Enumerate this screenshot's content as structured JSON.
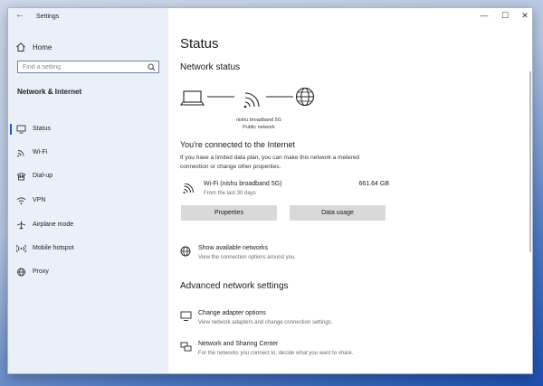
{
  "window": {
    "app_title": "Settings",
    "back_glyph": "←",
    "minimize_glyph": "—",
    "maximize_glyph": "☐",
    "close_glyph": "✕"
  },
  "sidebar": {
    "home_label": "Home",
    "search_placeholder": "Find a setting",
    "category": "Network & Internet",
    "items": [
      {
        "label": "Status",
        "icon": "status-icon",
        "selected": true
      },
      {
        "label": "Wi-Fi",
        "icon": "wifi-icon"
      },
      {
        "label": "Dial-up",
        "icon": "dialup-icon"
      },
      {
        "label": "VPN",
        "icon": "vpn-icon"
      },
      {
        "label": "Airplane mode",
        "icon": "airplane-icon"
      },
      {
        "label": "Mobile hotspot",
        "icon": "hotspot-icon"
      },
      {
        "label": "Proxy",
        "icon": "globe-icon"
      }
    ]
  },
  "main": {
    "title": "Status",
    "network_status_heading": "Network status",
    "network_name": "nishu broadband 5G",
    "network_type": "Public network",
    "connected_heading": "You're connected to the Internet",
    "connected_desc": "If you have a limited data plan, you can make this network a metered connection or change other properties.",
    "wifi": {
      "name": "Wi-Fi (nishu broadband 5G)",
      "sub": "From the last 30 days",
      "usage": "661.64 GB"
    },
    "buttons": {
      "properties": "Properties",
      "data_usage": "Data usage"
    },
    "show_networks": {
      "title": "Show available networks",
      "sub": "View the connection options around you."
    },
    "advanced_heading": "Advanced network settings",
    "change_adapter": {
      "title": "Change adapter options",
      "sub": "View network adapters and change connection settings."
    },
    "sharing_center": {
      "title": "Network and Sharing Center",
      "sub": "For the networks you connect to, decide what you want to share."
    }
  },
  "colors": {
    "accent": "#1f5bd0",
    "sidebar_bg": "#eaf0f8",
    "button_bg": "#d9d9d9"
  }
}
